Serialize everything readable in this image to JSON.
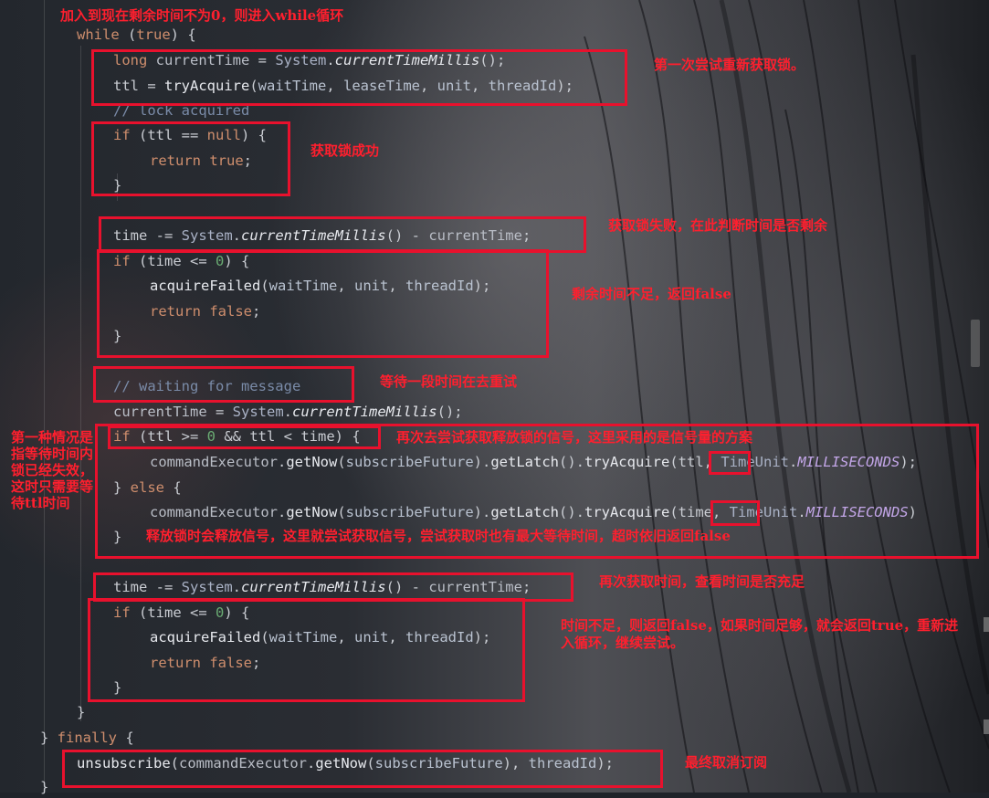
{
  "code": {
    "l1": [
      "while",
      " (",
      "true",
      ") {"
    ],
    "l2": [
      "long",
      " currentTime",
      " = ",
      "System",
      ".",
      "currentTimeMillis",
      "();"
    ],
    "l3": [
      "ttl",
      " = ",
      "tryAcquire",
      "(",
      "waitTime",
      ", ",
      "leaseTime",
      ", ",
      "unit",
      ", ",
      "threadId",
      ");"
    ],
    "l4": "// lock acquired",
    "l5": [
      "if",
      " (",
      "ttl",
      " == ",
      "null",
      ") {"
    ],
    "l6": [
      "return",
      " ",
      "true",
      ";"
    ],
    "l7": "}",
    "l8": [
      "time",
      " -= ",
      "System",
      ".",
      "currentTimeMillis",
      "()",
      " - ",
      "currentTime",
      ";"
    ],
    "l9": [
      "if",
      " (",
      "time",
      " <= ",
      "0",
      ") {"
    ],
    "l10": [
      "acquireFailed",
      "(",
      "waitTime",
      ", ",
      "unit",
      ", ",
      "threadId",
      ");"
    ],
    "l11": [
      "return",
      " ",
      "false",
      ";"
    ],
    "l12": "}",
    "l13": "// waiting for message",
    "l14": [
      "currentTime",
      " = ",
      "System",
      ".",
      "currentTimeMillis",
      "();"
    ],
    "l15": [
      "if",
      " (",
      "ttl",
      " >= ",
      "0",
      " && ",
      "ttl",
      " < ",
      "time",
      ") {"
    ],
    "l16": [
      "commandExecutor",
      ".",
      "getNow",
      "(",
      "subscribeFuture",
      ").",
      "getLatch",
      "().",
      "tryAcquire",
      "(",
      "ttl",
      ", ",
      "TimeUnit",
      ".",
      "MILLISECONDS",
      ");"
    ],
    "l17": [
      "}",
      " else ",
      "{"
    ],
    "l18": [
      "commandExecutor",
      ".",
      "getNow",
      "(",
      "subscribeFuture",
      ").",
      "getLatch",
      "().",
      "tryAcquire",
      "(",
      "time",
      ", ",
      "TimeUnit",
      ".",
      "MILLISECONDS",
      ")"
    ],
    "l19": "}",
    "l20": [
      "time",
      " -= ",
      "System",
      ".",
      "currentTimeMillis",
      "()",
      " - ",
      "currentTime",
      ";"
    ],
    "l21": [
      "if",
      " (",
      "time",
      " <= ",
      "0",
      ") {"
    ],
    "l22": [
      "acquireFailed",
      "(",
      "waitTime",
      ", ",
      "unit",
      ", ",
      "threadId",
      ");"
    ],
    "l23": [
      "return",
      " ",
      "false",
      ";"
    ],
    "l24": "}",
    "l25": "}",
    "l26": [
      "}",
      " finally ",
      "{"
    ],
    "l27": [
      "unsubscribe",
      "(",
      "commandExecutor",
      ".",
      "getNow",
      "(",
      "subscribeFuture",
      "), ",
      "threadId",
      ");"
    ],
    "l28": "}"
  },
  "annotations": {
    "top": "加入到现在剩余时间不为0，则进入while循环",
    "first_try": "第一次尝试重新获取锁。",
    "acquired": "获取锁成功",
    "failed_check": "获取锁失败，在此判断时间是否剩余",
    "not_enough": "剩余时间不足，返回false",
    "wait": "等待一段时间在去重试",
    "signal": "再次去尝试获取释放锁的信号，这里采用的是信号量的方案",
    "left_case": "第一种情况是指等待时间内锁已经失效，这时只需要等待ttl时间",
    "release": "释放锁时会释放信号，这里就尝试获取信号，尝试获取时也有最大等待时间，超时依旧返回false",
    "again_time": "再次获取时间，查看时间是否充足",
    "final_check": "时间不足，则返回false，如果时间足够，就会返回true，重新进入循环，继续尝试。",
    "unsubscribe": "最终取消订阅"
  },
  "colors": {
    "annotation": "#ff1f2e",
    "box": "#e8112d",
    "keyword": "#cf8e6d",
    "comment": "#7a8ba8",
    "number": "#6aab73",
    "constant": "#c3a6e8"
  }
}
